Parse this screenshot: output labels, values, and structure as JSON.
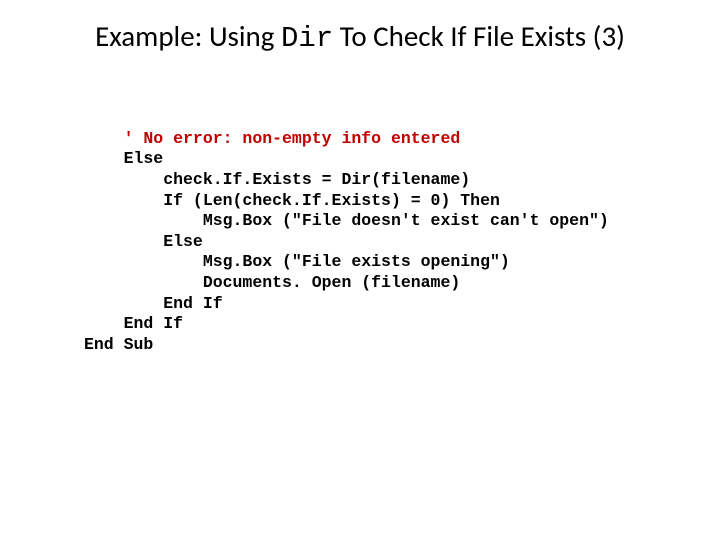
{
  "title": {
    "prefix": "Example: Using ",
    "mono": "Dir",
    "suffix": " To Check If  File Exists (3)"
  },
  "code": {
    "l1": "    ' No error: non-empty info entered",
    "l2": "    Else",
    "l3": "        check.If.Exists = Dir(filename)",
    "l4": "        If (Len(check.If.Exists) = 0) Then",
    "l5": "            Msg.Box (\"File doesn't exist can't open\")",
    "l6": "        Else",
    "l7": "            Msg.Box (\"File exists opening\")",
    "l8": "            Documents. Open (filename)",
    "l9": "        End If",
    "l10": "    End If",
    "l11": "End Sub"
  }
}
